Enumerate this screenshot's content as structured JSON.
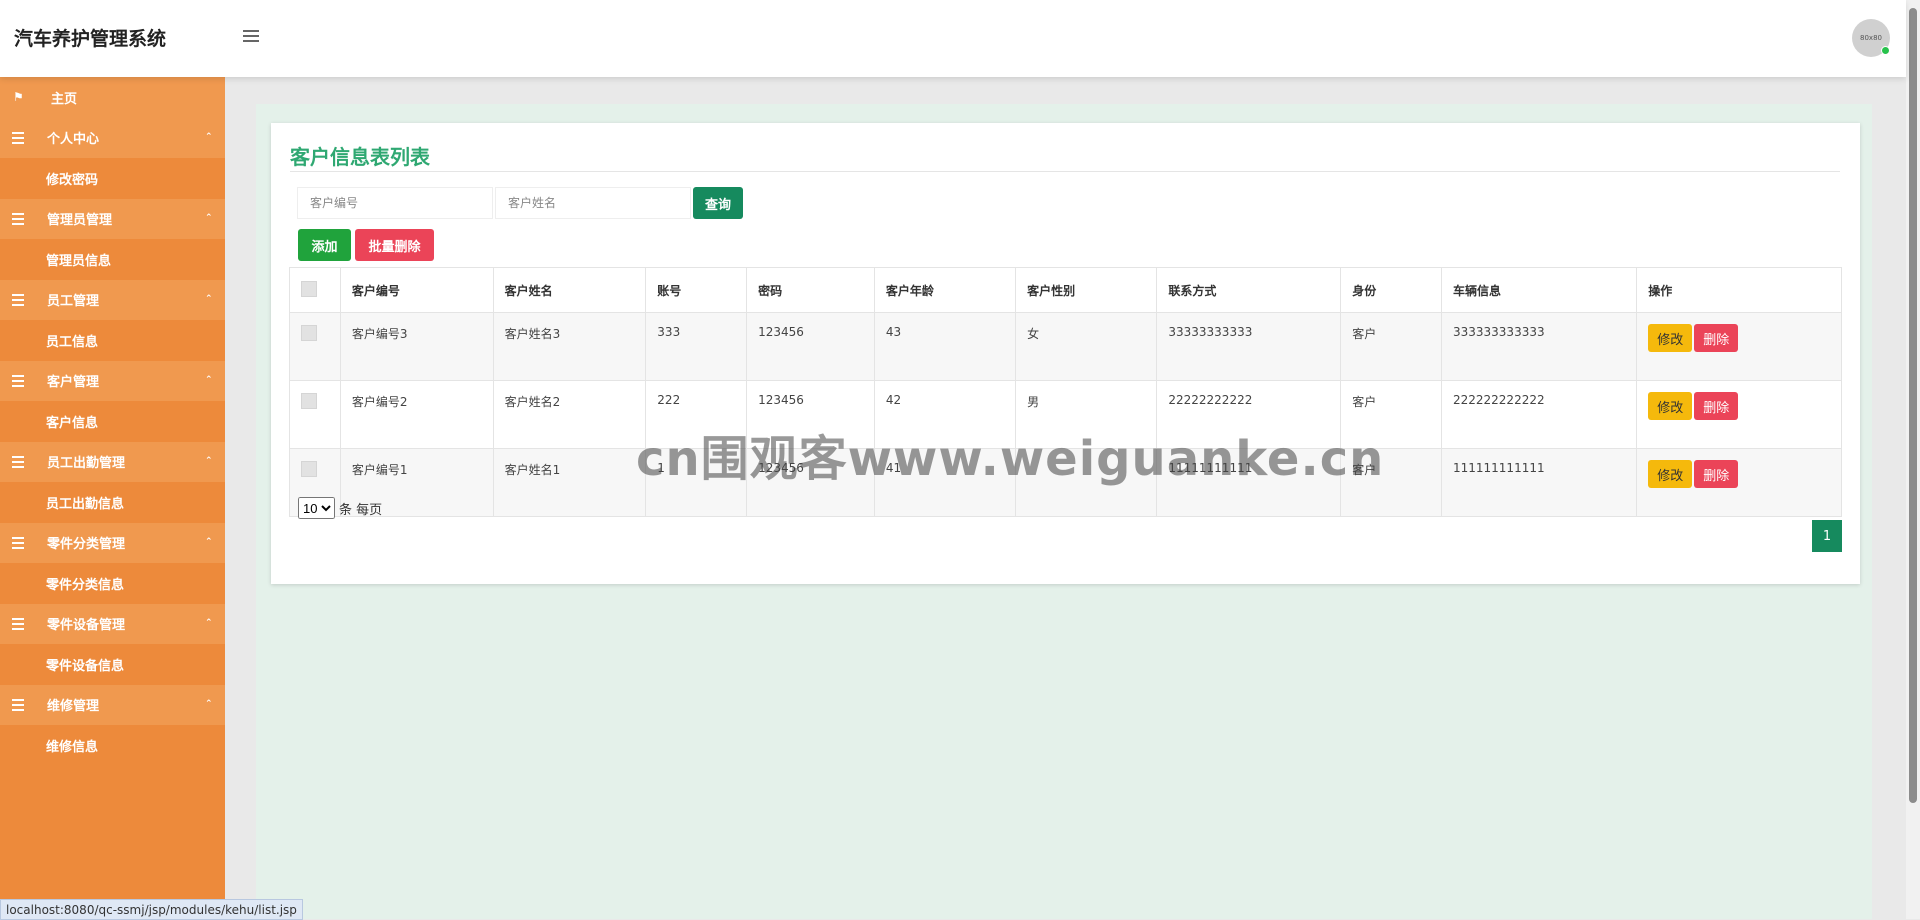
{
  "app": {
    "title": "汽车养护管理系统",
    "avatar_text": "80x80"
  },
  "sidebar": {
    "home": "主页",
    "groups": [
      {
        "label": "个人中心",
        "sub": "修改密码"
      },
      {
        "label": "管理员管理",
        "sub": "管理员信息"
      },
      {
        "label": "员工管理",
        "sub": "员工信息"
      },
      {
        "label": "客户管理",
        "sub": "客户信息"
      },
      {
        "label": "员工出勤管理",
        "sub": "员工出勤信息"
      },
      {
        "label": "零件分类管理",
        "sub": "零件分类信息"
      },
      {
        "label": "零件设备管理",
        "sub": "零件设备信息"
      },
      {
        "label": "维修管理",
        "sub": "维修信息"
      }
    ]
  },
  "page": {
    "title": "客户信息表列表",
    "search": {
      "code_placeholder": "客户编号",
      "name_placeholder": "客户姓名",
      "query_label": "查询"
    },
    "actions": {
      "add_label": "添加",
      "batch_delete_label": "批量删除"
    },
    "table": {
      "headers": [
        "客户编号",
        "客户姓名",
        "账号",
        "密码",
        "客户年龄",
        "客户性别",
        "联系方式",
        "身份",
        "车辆信息",
        "操作"
      ],
      "rows": [
        {
          "code": "客户编号3",
          "name": "客户姓名3",
          "account": "333",
          "password": "123456",
          "age": "43",
          "gender": "女",
          "phone": "33333333333",
          "role": "客户",
          "vehicle": "333333333333"
        },
        {
          "code": "客户编号2",
          "name": "客户姓名2",
          "account": "222",
          "password": "123456",
          "age": "42",
          "gender": "男",
          "phone": "22222222222",
          "role": "客户",
          "vehicle": "222222222222"
        },
        {
          "code": "客户编号1",
          "name": "客户姓名1",
          "account": "1",
          "password": "123456",
          "age": "41",
          "gender": "",
          "phone": "11111111111",
          "role": "客户",
          "vehicle": "111111111111"
        }
      ],
      "edit_label": "修改",
      "delete_label": "删除"
    },
    "pagination": {
      "page_size": "10",
      "page_size_suffix": "条 每页",
      "current_page": "1"
    }
  },
  "watermark": "cn围观客www.weiguanke.cn",
  "status_url": "localhost:8080/qc-ssmj/jsp/modules/kehu/list.jsp"
}
